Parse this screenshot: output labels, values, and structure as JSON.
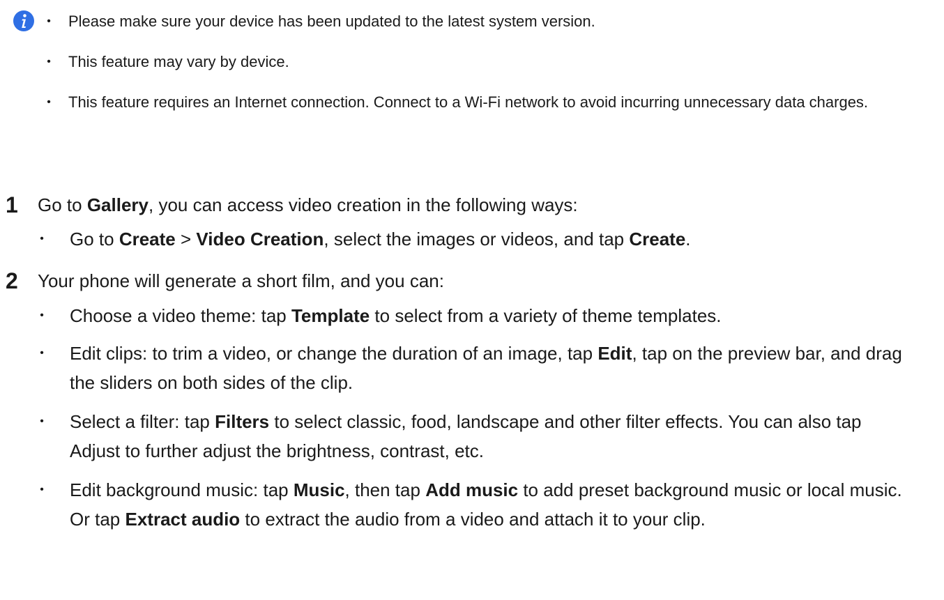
{
  "notes": [
    "Please make sure your device has been updated to the latest system version.",
    "This feature may vary by device.",
    "This feature requires an Internet connection. Connect to a Wi-Fi network to avoid incurring unnecessary data charges."
  ],
  "bullet": "•",
  "steps": [
    {
      "number": "1",
      "head": {
        "a": "Go to ",
        "b1": "Gallery",
        "c": ", you can access video creation in the following ways:"
      },
      "items": [
        {
          "t1": "Go to ",
          "b1": "Create",
          "t2": " > ",
          "b2": "Video Creation",
          "t3": ", select the images or videos, and tap ",
          "b3": "Create",
          "t4": "."
        }
      ]
    },
    {
      "number": "2",
      "head": {
        "a": "Your phone will generate a short film, and you can:"
      },
      "items": [
        {
          "t1": "Choose a video theme: tap ",
          "b1": "Template",
          "t2": " to select from a variety of theme templates."
        },
        {
          "t1": "Edit clips: to trim a video, or change the duration of an image, tap ",
          "b1": "Edit",
          "t2": ", tap on the preview bar, and drag the sliders on both sides of the clip."
        },
        {
          "t1": "Select a filter: tap ",
          "b1": "Filters",
          "t2": " to select classic, food, landscape and other filter effects. You can also tap Adjust to further adjust the brightness, contrast, etc."
        },
        {
          "t1": "Edit background music: tap ",
          "b1": "Music",
          "t2": ", then tap ",
          "b2": "Add music",
          "t3": " to add preset background music or local music. Or tap ",
          "b3": "Extract audio",
          "t4": " to extract the audio from a video and attach it to your clip."
        }
      ]
    }
  ],
  "colors": {
    "info_icon": "#2f6fe4",
    "text": "#1a1a1a"
  }
}
